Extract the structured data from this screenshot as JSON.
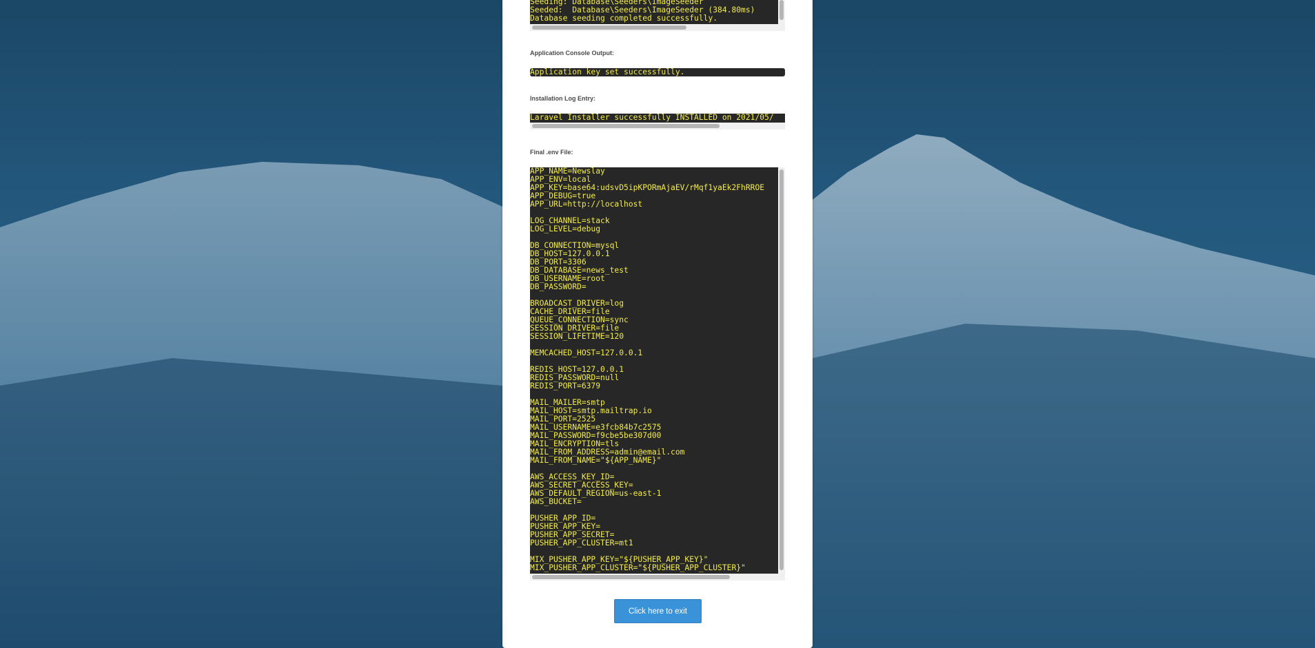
{
  "seed_output": {
    "lines": "Seeding: Database\\Seeders\\ImageSeeder\nSeeded:  Database\\Seeders\\ImageSeeder (384.80ms)\nDatabase seeding completed successfully."
  },
  "app_console": {
    "label": "Application Console Output:",
    "text": "Application key set successfully."
  },
  "install_log": {
    "label": "Installation Log Entry:",
    "text": "Laravel Installer successfully INSTALLED on 2021/05/"
  },
  "env_file": {
    "label": "Final .env File:",
    "text": "APP_NAME=Newslay\nAPP_ENV=local\nAPP_KEY=base64:udsvD5ipKPORmAjaEV/rMqf1yaEk2FhRROE\nAPP_DEBUG=true\nAPP_URL=http://localhost\n\nLOG_CHANNEL=stack\nLOG_LEVEL=debug\n\nDB_CONNECTION=mysql\nDB_HOST=127.0.0.1\nDB_PORT=3306\nDB_DATABASE=news_test\nDB_USERNAME=root\nDB_PASSWORD=\n\nBROADCAST_DRIVER=log\nCACHE_DRIVER=file\nQUEUE_CONNECTION=sync\nSESSION_DRIVER=file\nSESSION_LIFETIME=120\n\nMEMCACHED_HOST=127.0.0.1\n\nREDIS_HOST=127.0.0.1\nREDIS_PASSWORD=null\nREDIS_PORT=6379\n\nMAIL_MAILER=smtp\nMAIL_HOST=smtp.mailtrap.io\nMAIL_PORT=2525\nMAIL_USERNAME=e3fcb84b7c2575\nMAIL_PASSWORD=f9cbe5be307d00\nMAIL_ENCRYPTION=tls\nMAIL_FROM_ADDRESS=admin@email.com\nMAIL_FROM_NAME=\"${APP_NAME}\"\n\nAWS_ACCESS_KEY_ID=\nAWS_SECRET_ACCESS_KEY=\nAWS_DEFAULT_REGION=us-east-1\nAWS_BUCKET=\n\nPUSHER_APP_ID=\nPUSHER_APP_KEY=\nPUSHER_APP_SECRET=\nPUSHER_APP_CLUSTER=mt1\n\nMIX_PUSHER_APP_KEY=\"${PUSHER_APP_KEY}\"\nMIX_PUSHER_APP_CLUSTER=\"${PUSHER_APP_CLUSTER}\""
  },
  "exit_button": {
    "label": "Click here to exit"
  },
  "colors": {
    "console_bg": "#272727",
    "console_text": "#f3ec4a",
    "button_bg": "#3a93d8",
    "background": "#23577c"
  }
}
